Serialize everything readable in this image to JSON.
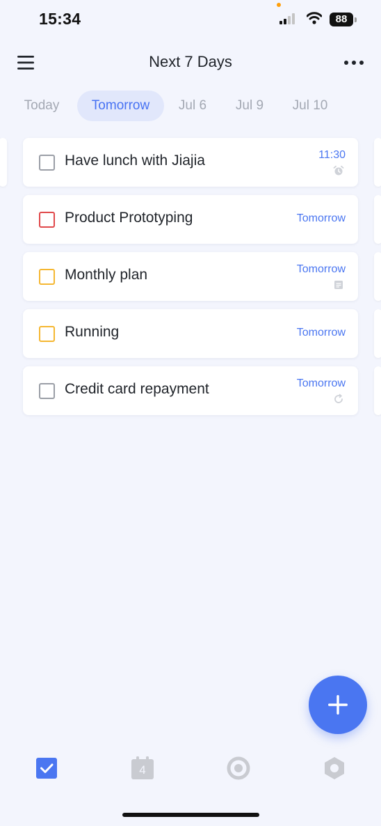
{
  "status_bar": {
    "time": "15:34",
    "battery": "88"
  },
  "header": {
    "title": "Next 7 Days"
  },
  "tabs": [
    {
      "label": "Today",
      "active": false
    },
    {
      "label": "Tomorrow",
      "active": true
    },
    {
      "label": "Jul 6",
      "active": false
    },
    {
      "label": "Jul 9",
      "active": false
    },
    {
      "label": "Jul 10",
      "active": false
    }
  ],
  "tasks": [
    {
      "name": "Have lunch with Jiajia",
      "date": "11:30",
      "priority_color": "#9a9ea6",
      "indicator": "alarm-icon"
    },
    {
      "name": "Product Prototyping",
      "date": "Tomorrow",
      "priority_color": "#e0484a",
      "indicator": ""
    },
    {
      "name": "Monthly plan",
      "date": "Tomorrow",
      "priority_color": "#f5b731",
      "indicator": "note-icon"
    },
    {
      "name": "Running",
      "date": "Tomorrow",
      "priority_color": "#f5b731",
      "indicator": ""
    },
    {
      "name": "Credit card repayment",
      "date": "Tomorrow",
      "priority_color": "#9a9ea6",
      "indicator": "repeat-icon"
    }
  ],
  "bottom_nav": [
    {
      "icon": "task-check-icon",
      "active": true
    },
    {
      "icon": "calendar-icon",
      "label": "4",
      "active": false
    },
    {
      "icon": "focus-icon",
      "active": false
    },
    {
      "icon": "settings-icon",
      "active": false
    }
  ],
  "colors": {
    "accent": "#4a76f1",
    "background": "#f3f5fd"
  }
}
